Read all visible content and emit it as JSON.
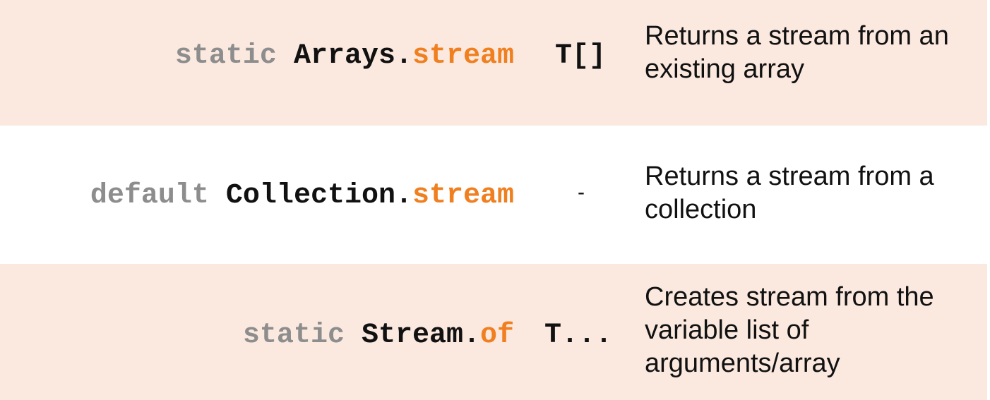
{
  "rows": [
    {
      "modifier": "static ",
      "class_name": "Arrays.",
      "method": "stream",
      "param": "T[]",
      "description": "Returns a stream from an existing array"
    },
    {
      "modifier": "default ",
      "class_name": "Collection.",
      "method": "stream",
      "param": "-",
      "description": "Returns a stream from a collection"
    },
    {
      "modifier": "static ",
      "class_name": "Stream.",
      "method": "of",
      "param": "T...",
      "description": "Creates stream from the variable list of arguments/array"
    }
  ],
  "colors": {
    "row_shaded": "#fbe9e0",
    "row_plain": "#ffffff",
    "modifier": "#8d8d8d",
    "class_name": "#111111",
    "method": "#f07f1f"
  }
}
